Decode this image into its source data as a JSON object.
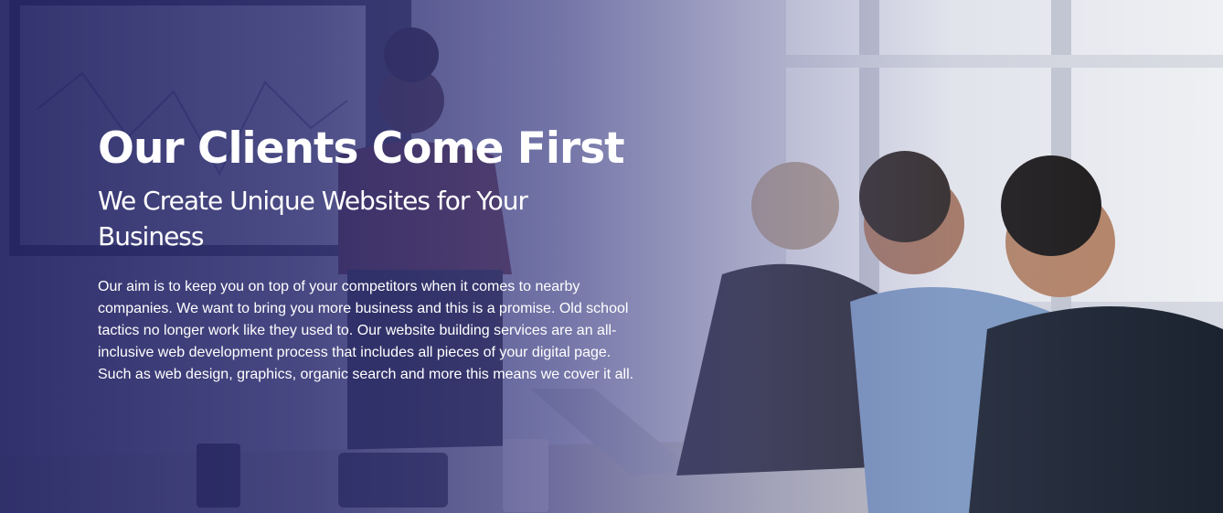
{
  "hero": {
    "title": "Our Clients Come First",
    "subtitle": "We Create Unique Websites for Your Business",
    "body": "Our aim is to keep you on top of your competitors when it comes to nearby companies. We want to bring you more business and this is a promise. Old school tactics no longer work like they used to. Our website building services are an all-inclusive web development process that includes all pieces of your digital page. Such as web design, graphics, organic search and more this means we cover it all.",
    "overlay_color": "#2a2a6e",
    "text_color": "#ffffff",
    "background_image": "office-meeting-photo"
  }
}
